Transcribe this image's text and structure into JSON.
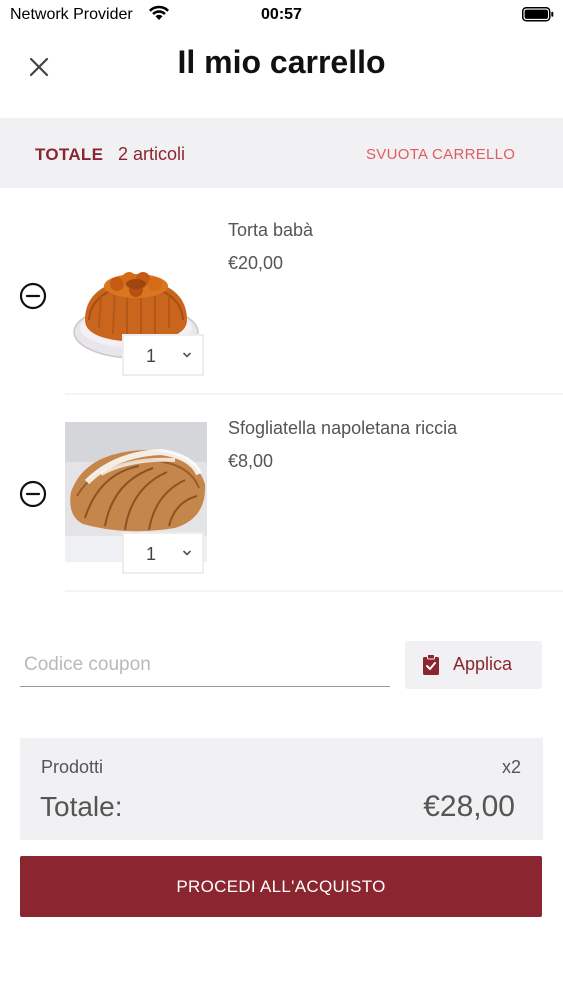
{
  "status_bar": {
    "carrier": "Network Provider",
    "time": "00:57"
  },
  "header": {
    "title": "Il mio carrello"
  },
  "summary": {
    "total_label": "TOTALE",
    "item_count": "2 articoli",
    "clear_label": "SVUOTA CARRELLO"
  },
  "items": [
    {
      "name": "Torta babà",
      "price": "€20,00",
      "quantity": "1"
    },
    {
      "name": "Sfogliatella napoletana riccia",
      "price": "€8,00",
      "quantity": "1"
    }
  ],
  "coupon": {
    "placeholder": "Codice coupon",
    "value": "",
    "apply_label": "Applica"
  },
  "totals": {
    "products_label": "Prodotti",
    "products_count": "x2",
    "total_label": "Totale:",
    "total_value": "€28,00"
  },
  "checkout": {
    "label": "PROCEDI ALL'ACQUISTO"
  },
  "colors": {
    "brand": "#8b2630",
    "accent_light": "#e05c63",
    "band_bg": "#f1f1f3"
  }
}
